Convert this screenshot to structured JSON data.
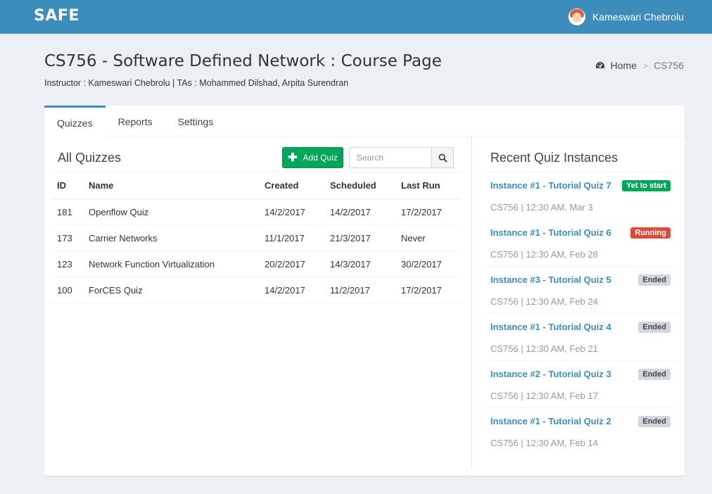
{
  "header": {
    "brand": "SAFE",
    "user_name": "Kameswari Chebrolu"
  },
  "page": {
    "title": "CS756 - Software Defined Network : Course Page",
    "subtitle": "Instructor : Kameswari Chebrolu | TAs : Mohammed Dilshad, Arpita Surendran",
    "breadcrumb": {
      "home": "Home",
      "separator": ">",
      "current": "CS756"
    }
  },
  "tabs": [
    {
      "label": "Quizzes",
      "active": true
    },
    {
      "label": "Reports",
      "active": false
    },
    {
      "label": "Settings",
      "active": false
    }
  ],
  "quizzes": {
    "title": "All Quizzes",
    "add_label": "Add Quiz",
    "search_placeholder": "Search",
    "columns": [
      "ID",
      "Name",
      "Created",
      "Scheduled",
      "Last Run"
    ],
    "rows": [
      [
        "181",
        "Openflow Quiz",
        "14/2/2017",
        "14/2/2017",
        "17/2/2017"
      ],
      [
        "173",
        "Carrier Networks",
        "11/1/2017",
        "21/3/2017",
        "Never"
      ],
      [
        "123",
        "Network Function Virtualization",
        "20/2/2017",
        "14/3/2017",
        "30/2/2017"
      ],
      [
        "100",
        "ForCES Quiz",
        "14/2/2017",
        "11/2/2017",
        "17/2/2017"
      ]
    ]
  },
  "recent": {
    "title": "Recent Quiz Instances",
    "items": [
      {
        "name": "Instance #1 - Tutorial Quiz 7",
        "meta": "CS756 | 12:30 AM, Mar 3",
        "status": "Yet to start",
        "status_color": "green"
      },
      {
        "name": "Instance #1 - Tutorial Quiz 6",
        "meta": "CS756 | 12:30 AM, Feb 28",
        "status": "Running",
        "status_color": "red"
      },
      {
        "name": "Instance #3 - Tutorial Quiz 5",
        "meta": "CS756 | 12:30 AM, Feb 24",
        "status": "Ended",
        "status_color": "gray"
      },
      {
        "name": "Instance #1 - Tutorial Quiz 4",
        "meta": "CS756 | 12:30 AM, Feb 21",
        "status": "Ended",
        "status_color": "gray"
      },
      {
        "name": "Instance #2 - Tutorial Quiz 3",
        "meta": "CS756 | 12:30 AM, Feb 17",
        "status": "Ended",
        "status_color": "gray"
      },
      {
        "name": "Instance #1 - Tutorial Quiz 2",
        "meta": "CS756 | 12:30 AM, Feb 14",
        "status": "Ended",
        "status_color": "gray"
      }
    ]
  },
  "colors": {
    "brand_bar": "#3c8dbc",
    "success": "#00a65a",
    "danger": "#dd4b39",
    "muted_badge": "#d2d6de",
    "background": "#ecf0f5"
  },
  "icons": {
    "breadcrumb_home": "dashboard-icon",
    "add": "plus-icon",
    "search": "search-icon"
  }
}
